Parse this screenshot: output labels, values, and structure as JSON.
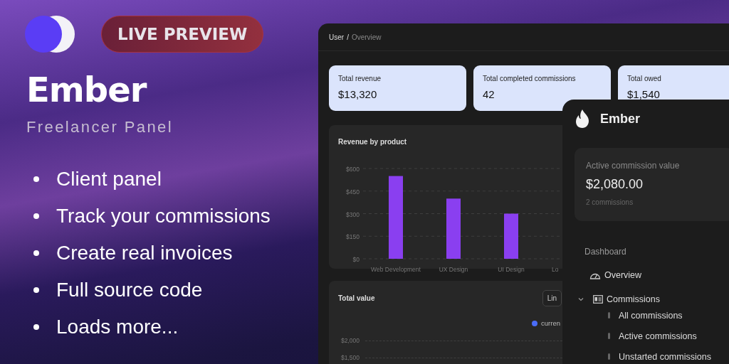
{
  "promo": {
    "badge": "LIVE PREVIEW",
    "title": "Ember",
    "subtitle": "Freelancer Panel",
    "features": [
      "Client panel",
      "Track your commissions",
      "Create real invoices",
      "Full source code",
      "Loads more..."
    ]
  },
  "dashboard": {
    "breadcrumb": {
      "parent": "User",
      "separator": "/",
      "current": "Overview"
    },
    "stats": [
      {
        "label": "Total revenue",
        "value": "$13,320"
      },
      {
        "label": "Total completed commissions",
        "value": "42"
      },
      {
        "label": "Total owed",
        "value": "$1,540"
      }
    ],
    "revenue_card": {
      "title": "Revenue by product",
      "chart_data": {
        "type": "bar",
        "categories": [
          "Web Development",
          "UX Design",
          "UI Design",
          "Lo"
        ],
        "values": [
          550,
          400,
          300,
          null
        ],
        "ylim": [
          0,
          600
        ],
        "grid": true,
        "yticks": [
          {
            "value": 0,
            "label": "$0"
          },
          {
            "value": 150,
            "label": "$150"
          },
          {
            "value": 300,
            "label": "$300"
          },
          {
            "value": 450,
            "label": "$450"
          },
          {
            "value": 600,
            "label": "$600"
          }
        ]
      }
    },
    "value_card": {
      "title": "Total value",
      "chart_type_button": "Lin",
      "legend": [
        {
          "label": "curren",
          "color": "#4a6cf7"
        }
      ],
      "axis_labels": [
        "$2,000",
        "$1,500"
      ]
    }
  },
  "sidebar": {
    "brand": "Ember",
    "active_card": {
      "label": "Active commission value",
      "value": "$2,080.00",
      "count": "2 commissions"
    },
    "section": "Dashboard",
    "items": [
      {
        "label": "Overview",
        "kind": "link"
      },
      {
        "label": "Commissions",
        "kind": "group",
        "expanded": true,
        "children": [
          {
            "label": "All commissions"
          },
          {
            "label": "Active commissions"
          },
          {
            "label": "Unstarted commissions"
          }
        ]
      }
    ]
  }
}
